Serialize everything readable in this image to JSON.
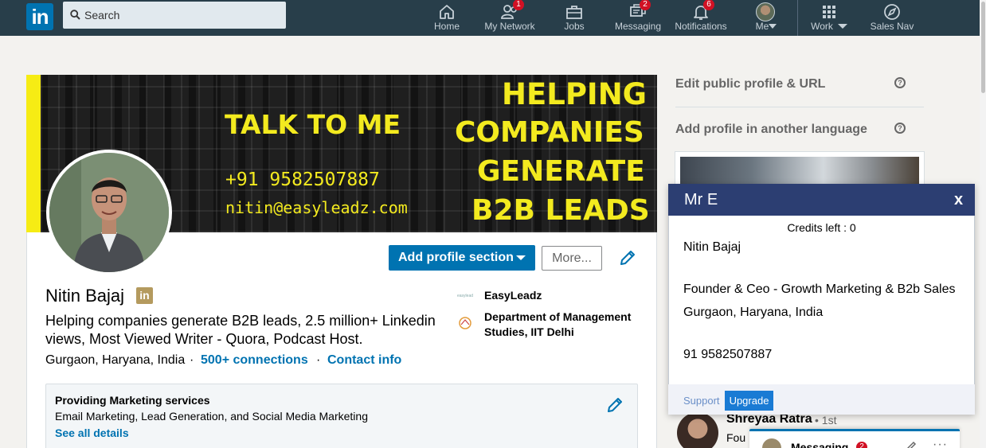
{
  "nav": {
    "logo": "in",
    "search_placeholder": "Search",
    "items": [
      {
        "label": "Home",
        "icon": "home-icon"
      },
      {
        "label": "My Network",
        "icon": "network-icon",
        "badge": "1"
      },
      {
        "label": "Jobs",
        "icon": "jobs-icon"
      },
      {
        "label": "Messaging",
        "icon": "messaging-icon",
        "badge": "2"
      },
      {
        "label": "Notifications",
        "icon": "bell-icon",
        "badge": "6"
      },
      {
        "label": "Me",
        "icon": "avatar"
      },
      {
        "label": "Work",
        "icon": "grid-icon"
      },
      {
        "label": "Sales Nav",
        "icon": "compass-icon"
      }
    ]
  },
  "banner": {
    "talk": "TALK TO ME",
    "phone": "+91 9582507887",
    "email": "nitin@easyleadz.com",
    "lines": [
      "HELPING",
      "COMPANIES",
      "GENERATE",
      "B2B LEADS"
    ]
  },
  "profile": {
    "add_section_label": "Add profile section",
    "more_label": "More...",
    "name": "Nitin Bajaj",
    "badge": "in",
    "headline": "Helping companies generate B2B leads, 2.5 million+ Linkedin views, Most Viewed Writer - Quora, Podcast Host.",
    "location": "Gurgaon, Haryana, India",
    "separator": "·",
    "connections": "500+ connections",
    "contact": "Contact info",
    "company": "EasyLeadz",
    "education": "Department of Management Studies, IIT Delhi",
    "company_logo_text": "easyleadz"
  },
  "services": {
    "title": "Providing Marketing services",
    "desc": "Email Marketing, Lead Generation, and Social Media Marketing",
    "link": "See all details"
  },
  "rail": {
    "edit_url": "Edit public profile & URL",
    "add_language": "Add profile in another language",
    "help": "?"
  },
  "people": {
    "name": "Shreyaa Ratra",
    "degree": "• 1st",
    "sub": "Fou"
  },
  "messaging": {
    "label": "Messaging",
    "badge": "2",
    "more": "···"
  },
  "popup": {
    "title": "Mr E",
    "close": "x",
    "credits": "Credits left : 0",
    "name": "Nitin Bajaj",
    "role": "Founder & Ceo - Growth Marketing & B2b Sales",
    "location": "Gurgaon, Haryana, India",
    "phone": "91 9582507887",
    "support": "Support",
    "upgrade": "Upgrade"
  },
  "colors": {
    "nav_bg": "#283e4a",
    "accent": "#0073b1",
    "banner_yellow": "#f3ea1f",
    "popup_header": "#2c3e72",
    "badge_red": "#d11124"
  }
}
